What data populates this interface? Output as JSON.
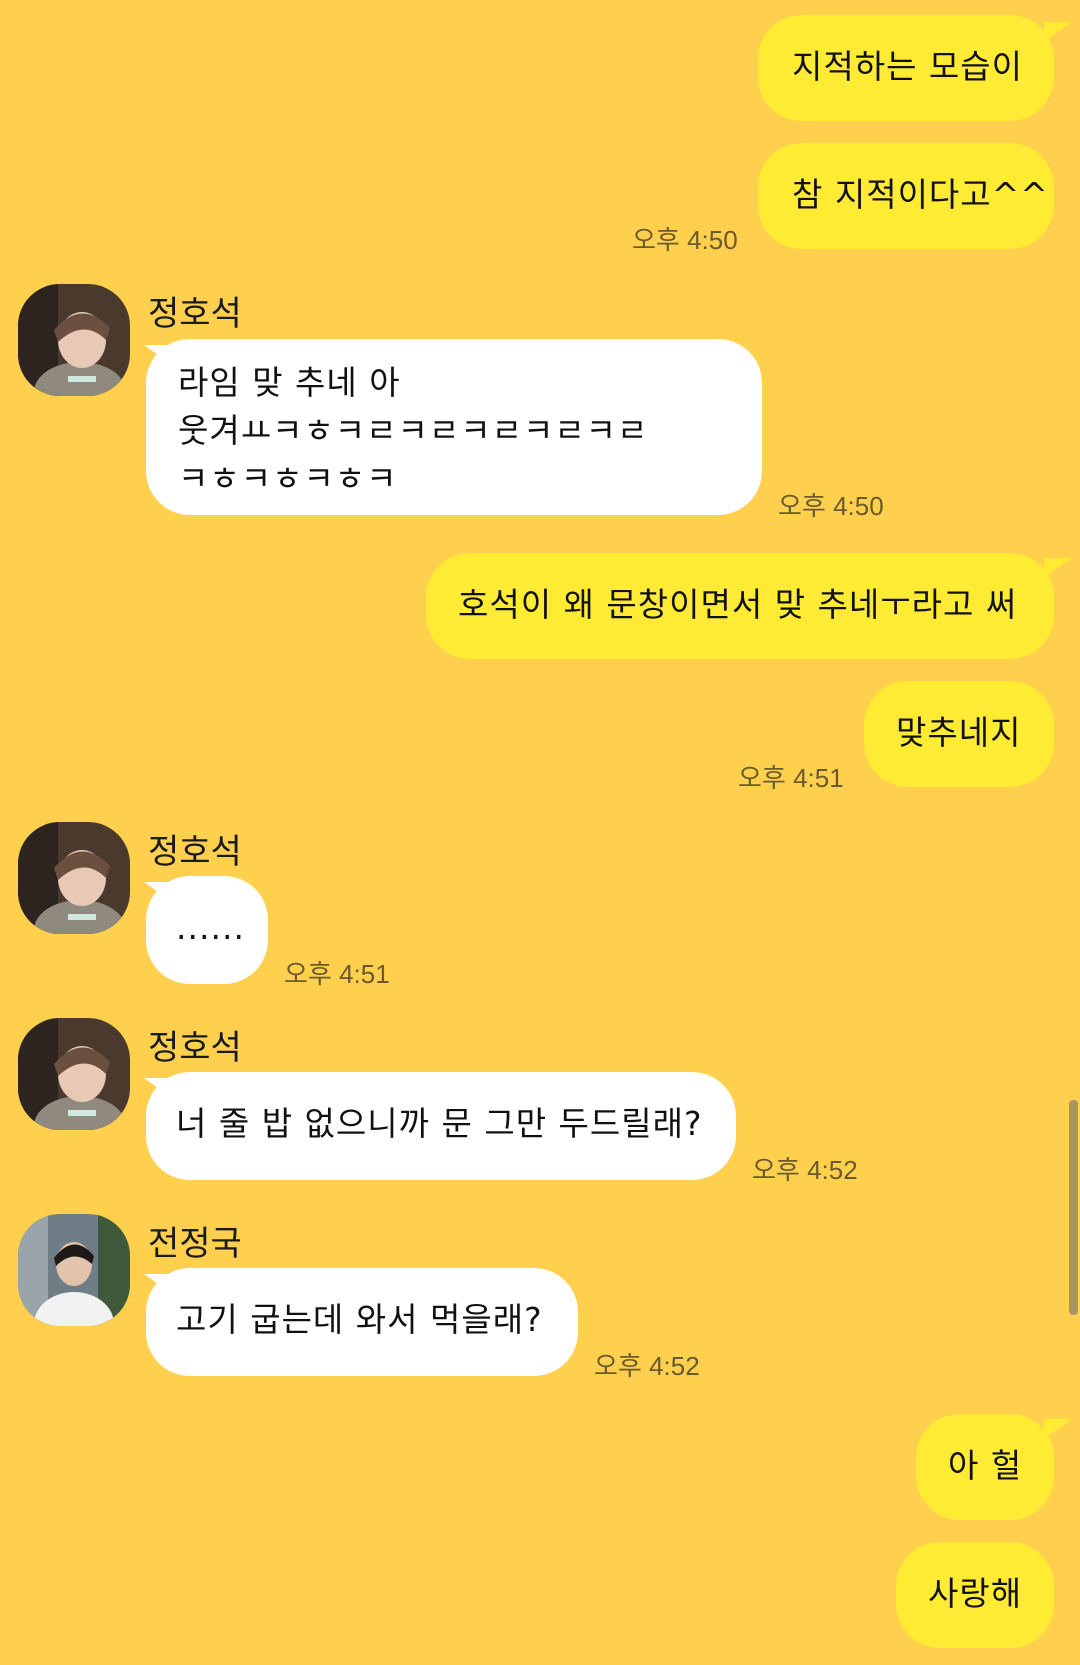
{
  "messages": [
    {
      "sender": "me",
      "text": "지적하는 모습이"
    },
    {
      "sender": "me",
      "text": "참 지적이다고^^",
      "time": "오후 4:50"
    },
    {
      "sender": "정호석",
      "lines": [
        "라임 맞 추네 아",
        "웃겨ㅛㅋㅎㅋㄹㅋㄹㅋㄹㅋㄹㅋㄹ",
        "ㅋㅎㅋㅎㅋㅎㅋ"
      ],
      "time": "오후 4:50"
    },
    {
      "sender": "me",
      "text": "호석이 왜 문창이면서 맞 추네ㅜ라고 써"
    },
    {
      "sender": "me",
      "text": "맞추네지",
      "time": "오후 4:51"
    },
    {
      "sender": "정호석",
      "text": "......",
      "time": "오후 4:51"
    },
    {
      "sender": "정호석",
      "text": "너 줄 밥 없으니까 문 그만 두드릴래?",
      "time": "오후 4:52"
    },
    {
      "sender": "전정국",
      "text": "고기 굽는데 와서 먹을래?",
      "time": "오후 4:52"
    },
    {
      "sender": "me",
      "text": "아 헐"
    },
    {
      "sender": "me",
      "text": "사랑해"
    }
  ],
  "avatars": {
    "hoseok": "avatar-hoseok-icon",
    "jungkook": "avatar-jungkook-icon"
  },
  "colors": {
    "background": "#ffd04e",
    "outgoing_bubble": "#ffeb33",
    "incoming_bubble": "#ffffff"
  }
}
